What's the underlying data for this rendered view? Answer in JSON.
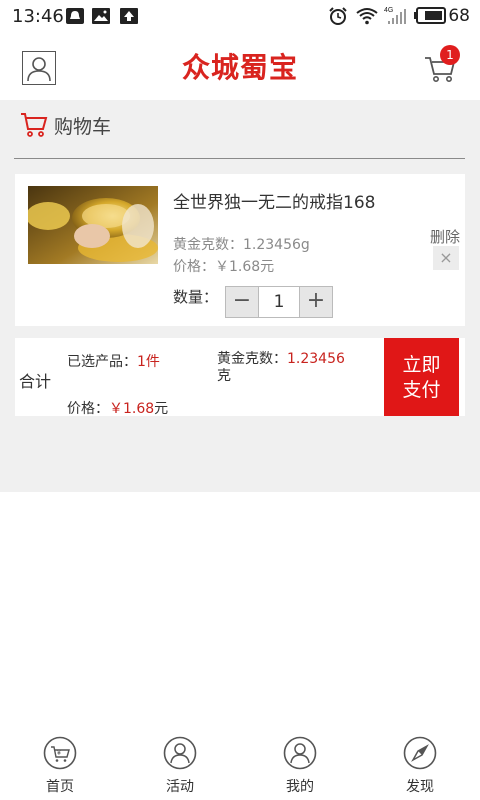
{
  "status_bar": {
    "time": "13:46",
    "battery": "68",
    "network": "4G"
  },
  "header": {
    "brand": "众城蜀宝",
    "cart_badge": "1"
  },
  "page": {
    "title": "购物车"
  },
  "product": {
    "name": "全世界独一无二的戒指168",
    "weight_label": "黄金克数：",
    "weight_value": "1.23456g",
    "price_label": "价格：",
    "price_value": "￥1.68元",
    "delete_label": "删除",
    "delete_icon": "×",
    "qty_label": "数量：",
    "qty_minus": "−",
    "qty_value": "1",
    "qty_plus": "+"
  },
  "summary": {
    "total_label": "合计",
    "count_label": "已选产品：",
    "count_value": "1件",
    "weight_label": "黄金克数：",
    "weight_value": "1.23456",
    "weight_unit": "克",
    "price_label": "价格：",
    "price_value": "￥1.68",
    "price_unit": "元",
    "pay_line1": "立即",
    "pay_line2": "支付"
  },
  "bottom_nav": [
    {
      "label": "首页",
      "icon": "home-cart-icon"
    },
    {
      "label": "活动",
      "icon": "activity-user-icon"
    },
    {
      "label": "我的",
      "icon": "profile-icon"
    },
    {
      "label": "发现",
      "icon": "compass-icon"
    }
  ],
  "colors": {
    "accent": "#e01717",
    "brand": "#d9241f",
    "content_bg": "#f0f0f0"
  }
}
